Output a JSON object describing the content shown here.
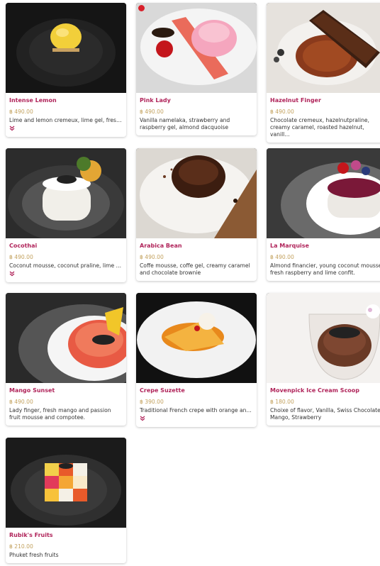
{
  "colors": {
    "accent": "#b0245a",
    "price": "#c3a25f",
    "text": "#333333",
    "badge": "#d81f2a"
  },
  "items": [
    {
      "name": "Intense Lemon",
      "price": "฿ 490.00",
      "description": "Lime and lemon cremeux, lime gel, fresh...",
      "expand_icon": "chevron-double-down-icon"
    },
    {
      "name": "Pink Lady",
      "price": "฿ 490.00",
      "description": "Vanilla namelaka, strawberry and raspberry gel, almond dacquoise",
      "badge_icon": "status-dot-icon"
    },
    {
      "name": "Hazelnut Finger",
      "price": "฿ 490.00",
      "description": "Chocolate cremeux, hazelnutpraline, creamy caramel, roasted hazelnut, vanill..."
    },
    {
      "name": "Cocothai",
      "price": "฿ 490.00",
      "description": "Coconut mousse, coconut praline, lime g...",
      "expand_icon": "chevron-double-down-icon"
    },
    {
      "name": "Arabica Bean",
      "price": "฿ 490.00",
      "description": "Coffe mousse, coffe gel, creamy caramel and chocolate brownie"
    },
    {
      "name": "La Marquise",
      "price": "฿ 490.00",
      "description": "Almond financier, young coconut mousse, fresh raspberry and lime confit."
    },
    {
      "name": "Mango Sunset",
      "price": "฿ 490.00",
      "description": "Lady finger, fresh mango and passion fruit mousse and compotee."
    },
    {
      "name": "Crepe Suzette",
      "price": "฿ 390.00",
      "description": "Traditional French crepe with orange an...",
      "expand_icon": "chevron-double-down-icon"
    },
    {
      "name": "Movenpick Ice Cream Scoop",
      "price": "฿ 180.00",
      "description": "Choixe of flavor, Vanilla, Swiss Chocolate, Mango, Strawberry"
    },
    {
      "name": "Rubik's Fruits",
      "price": "฿ 210.00",
      "description": "Phuket fresh fruits"
    }
  ]
}
